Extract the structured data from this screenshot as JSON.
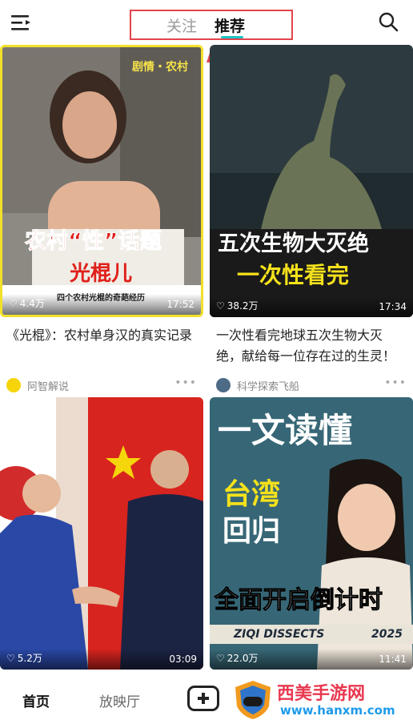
{
  "header": {
    "tabs": [
      {
        "label": "关注",
        "active": false
      },
      {
        "label": "推荐",
        "active": true
      }
    ],
    "menu_icon": "menu-icon",
    "search_icon": "search-icon"
  },
  "feed": [
    {
      "overlay_top": "剧情・农村",
      "overlay_main": "农村“性”话题",
      "overlay_sub": "光棍儿",
      "overlay_caption": "四个农村光棍的奇葩经历",
      "likes": "4.4万",
      "duration": "17:52",
      "title": "《光棍》：农村单身汉的真实记录",
      "author": "阿智解说"
    },
    {
      "overlay_main": "五次生物大灭绝",
      "overlay_sub": "一次性看完",
      "likes": "38.2万",
      "duration": "17:34",
      "title": "一次性看完地球五次生物大灭绝，献给每一位存在过的生灵！",
      "author": "科学探索飞船"
    },
    {
      "likes": "5.2万",
      "duration": "03:09"
    },
    {
      "overlay_top": "一文读懂",
      "overlay_main": "台湾",
      "overlay_main2": "回归",
      "overlay_sub": "全面开启倒计时",
      "overlay_brand": "ZIQI DISSECTS",
      "overlay_year": "2025",
      "likes": "22.0万",
      "duration": "11:41"
    }
  ],
  "bottom_nav": {
    "home": "首页",
    "theater": "放映厅",
    "add_icon": "plus-square-icon"
  },
  "watermark": {
    "text": "西美手游网",
    "url": "www.hanxm.com"
  },
  "colors": {
    "accent": "#1dc4c4",
    "annotation": "#e2444c"
  }
}
